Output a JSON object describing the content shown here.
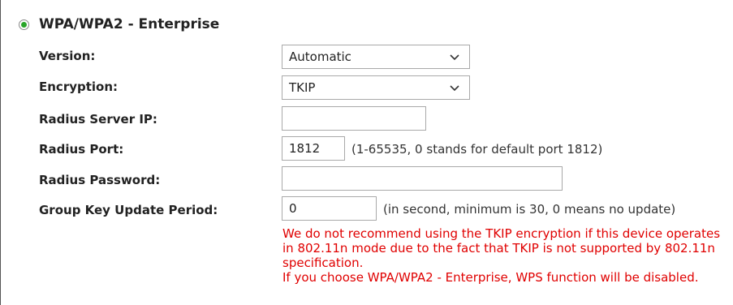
{
  "section": {
    "title": "WPA/WPA2 - Enterprise",
    "selected": true
  },
  "fields": {
    "version": {
      "label": "Version:",
      "value": "Automatic"
    },
    "encryption": {
      "label": "Encryption:",
      "value": "TKIP"
    },
    "radius_ip": {
      "label": "Radius Server IP:",
      "value": ""
    },
    "radius_port": {
      "label": "Radius Port:",
      "value": "1812",
      "hint": "(1-65535, 0 stands for default port 1812)"
    },
    "radius_password": {
      "label": "Radius Password:",
      "value": ""
    },
    "group_key": {
      "label": "Group Key Update Period:",
      "value": "0",
      "hint": "(in second, minimum is 30, 0 means no update)"
    }
  },
  "warnings": {
    "tkip": "We do not recommend using the TKIP encryption if this device operates in 802.11n mode due to the fact that TKIP is not supported by 802.11n specification.",
    "wps": "If you choose WPA/WPA2 - Enterprise, WPS function will be disabled."
  },
  "colors": {
    "radio_dot": "#2aa52a",
    "warning": "#e00000"
  }
}
